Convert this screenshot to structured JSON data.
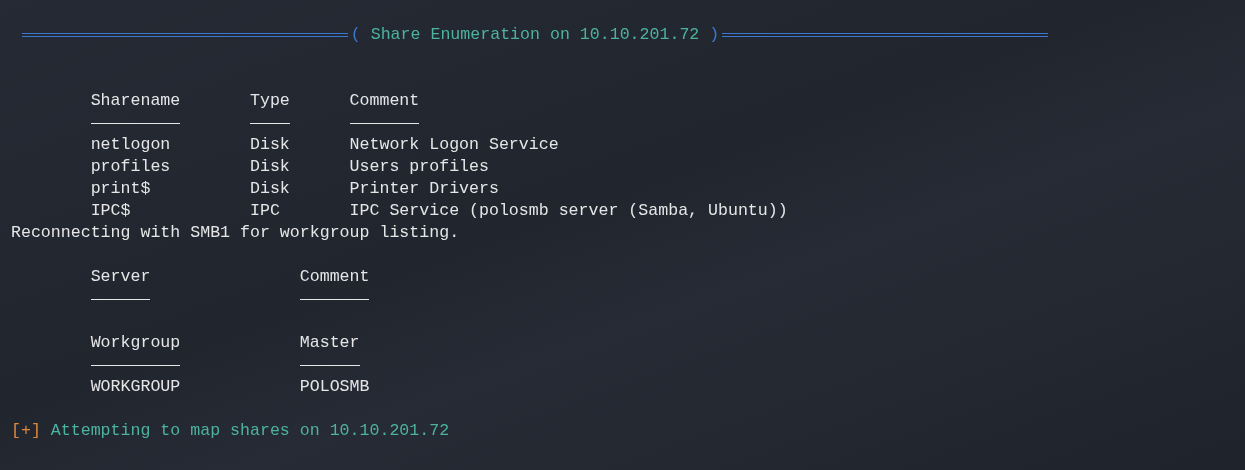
{
  "header": {
    "brackets": [
      "(",
      ")"
    ],
    "title": "Share Enumeration on 10.10.201.72"
  },
  "tables": [
    {
      "columns": [
        "Sharename",
        "Type",
        "Comment"
      ],
      "rows": [
        [
          "netlogon",
          "Disk",
          "Network Logon Service"
        ],
        [
          "profiles",
          "Disk",
          "Users profiles"
        ],
        [
          "print$",
          "Disk",
          "Printer Drivers"
        ],
        [
          "IPC$",
          "IPC",
          "IPC Service (polosmb server (Samba, Ubuntu))"
        ]
      ]
    }
  ],
  "message": "Reconnecting with SMB1 for workgroup listing.",
  "workgroup_tables": [
    {
      "columns": [
        "Server",
        "Comment"
      ]
    },
    {
      "columns": [
        "Workgroup",
        "Master"
      ],
      "rows": [
        [
          "WORKGROUP",
          "POLOSMB"
        ]
      ]
    }
  ],
  "status": {
    "tag": "[+]",
    "text": "Attempting to map shares on 10.10.201.72"
  }
}
